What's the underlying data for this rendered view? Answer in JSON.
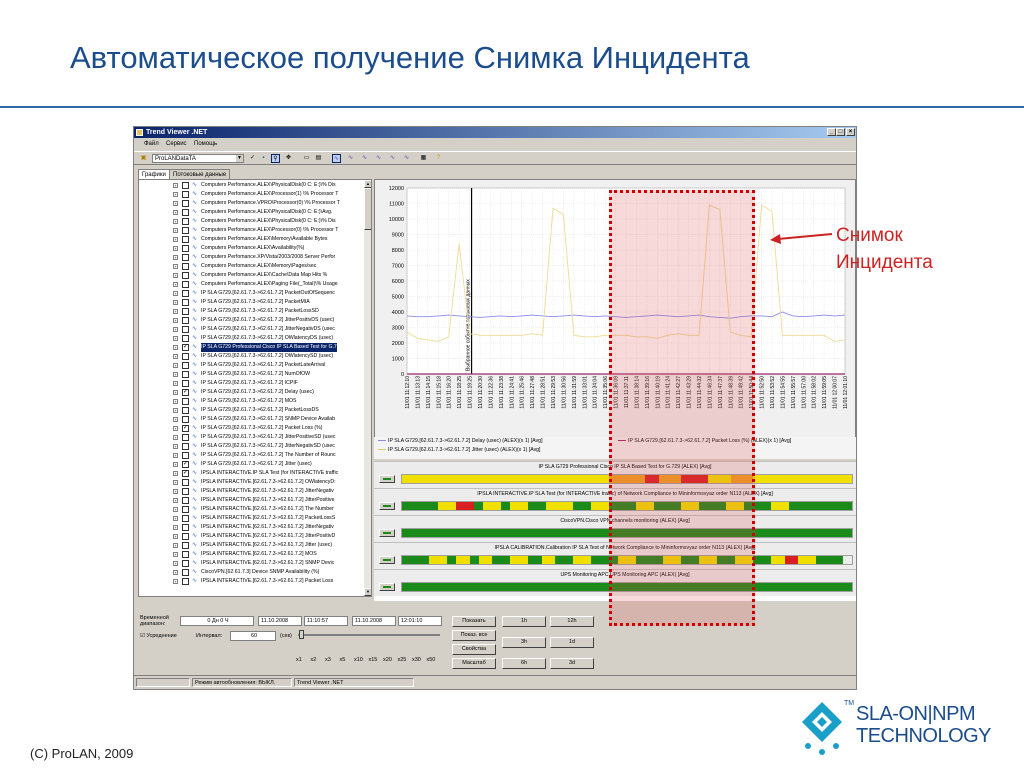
{
  "slide": {
    "title": "Автоматическое получение Снимка Инцидента",
    "footer": "(C) ProLAN, 2009",
    "callout_line1": "Снимок",
    "callout_line2": "Инцидента",
    "logo_line1": "SLA-ON|NPM",
    "logo_line2": "TECHNOLOGY",
    "logo_tm": "TM"
  },
  "colors": {
    "title": "#1b4d8c",
    "callout": "#cc2222",
    "highlight_border": "#cc0000",
    "status_green": "#1a8a1a",
    "status_yellow": "#f0e000",
    "status_red": "#d82020"
  },
  "window": {
    "title": "Trend Viewer .NET",
    "menu": [
      "Файл",
      "Сервис",
      "Помощь"
    ],
    "toolbar": {
      "source_combo": "ProLANDataTA"
    },
    "tabs": [
      "Графики",
      "Потоковые данные"
    ],
    "tree_items": [
      {
        "label": "Computers Perfomance.ALEX\\PhysicalDisk(0 C: E:)\\% Dis",
        "checked": false,
        "selected": false
      },
      {
        "label": "Computers Perfomance.ALEX\\Processor(1) \\% Processor T",
        "checked": false,
        "selected": false
      },
      {
        "label": "Computers Perfomance.VPRO\\Processor(0) \\% Processor T",
        "checked": false,
        "selected": false
      },
      {
        "label": "Computers Perfomance.ALEX\\PhysicalDisk(0 C: E:)\\Avg.",
        "checked": false,
        "selected": false
      },
      {
        "label": "Computers Perfomance.ALEX\\PhysicalDisk(0 C: E:)\\% Dis",
        "checked": false,
        "selected": false
      },
      {
        "label": "Computers Perfomance.ALEX\\Processor(0) \\% Processor T",
        "checked": false,
        "selected": false
      },
      {
        "label": "Computers Perfomance.ALEX\\Memory\\Available Bytes",
        "checked": false,
        "selected": false
      },
      {
        "label": "Computers Perfomance.ALEX\\Availability(%)",
        "checked": false,
        "selected": false
      },
      {
        "label": "Computers Perfomance.XP/Vista/2003/2008 Server Perfor",
        "checked": false,
        "selected": false
      },
      {
        "label": "Computers Perfomance.ALEX\\Memory\\Pages/sec",
        "checked": false,
        "selected": false
      },
      {
        "label": "Computers Perfomance.ALEX\\Cache\\Data Map Hits %",
        "checked": false,
        "selected": false
      },
      {
        "label": "Computers Perfomance.ALEX\\Paging File(_Total)\\% Usage",
        "checked": false,
        "selected": false
      },
      {
        "label": "IP SLA G729.[62.61.7.3->62.61.7.2]  PacketOutOfSequenc",
        "checked": false,
        "selected": false
      },
      {
        "label": "IP SLA G729.[62.61.7.3->62.61.7.2]  PacketMIA",
        "checked": false,
        "selected": false
      },
      {
        "label": "IP SLA G729.[62.61.7.3->62.61.7.2]  PacketLossSD",
        "checked": false,
        "selected": false
      },
      {
        "label": "IP SLA G729.[62.61.7.3->62.61.7.2]  JitterPositivDS (usec)",
        "checked": false,
        "selected": false
      },
      {
        "label": "IP SLA G729.[62.61.7.3->62.61.7.2]  JitterNegativDS (usec",
        "checked": false,
        "selected": false
      },
      {
        "label": "IP SLA G729.[62.61.7.3->62.61.7.2]  OWlatencyDS (usec)",
        "checked": false,
        "selected": false
      },
      {
        "label": "IP SLA G729 Professional Cisco IP SLA Based Test for G.7",
        "checked": true,
        "selected": true
      },
      {
        "label": "IP SLA G729.[62.61.7.3->62.61.7.2]  OWlatencySD (usec)",
        "checked": false,
        "selected": false
      },
      {
        "label": "IP SLA G729.[62.61.7.3->62.61.7.2]  PacketLateArrival",
        "checked": false,
        "selected": false
      },
      {
        "label": "IP SLA G729.[62.61.7.3->62.61.7.2]  NumOfOW",
        "checked": false,
        "selected": false
      },
      {
        "label": "IP SLA G729.[62.61.7.3->62.61.7.2]  ICPIF",
        "checked": false,
        "selected": false
      },
      {
        "label": "IP SLA G729.[62.61.7.3->62.61.7.2]  Delay (usec)",
        "checked": true,
        "selected": false
      },
      {
        "label": "IP SLA G729.[62.61.7.3->62.61.7.2]  MOS",
        "checked": false,
        "selected": false
      },
      {
        "label": "IP SLA G729.[62.61.7.3->62.61.7.2]  PacketLossDS",
        "checked": false,
        "selected": false
      },
      {
        "label": "IP SLA G729.[62.61.7.3->62.61.7.2]  SNMP Device Availab",
        "checked": false,
        "selected": false
      },
      {
        "label": "IP SLA G729.[62.61.7.3->62.61.7.2]  Packet Loss (%)",
        "checked": true,
        "selected": false
      },
      {
        "label": "IP SLA G729.[62.61.7.3->62.61.7.2]  JitterPositiveSD (usec",
        "checked": false,
        "selected": false
      },
      {
        "label": "IP SLA G729.[62.61.7.3->62.61.7.2]  JitterNegativSD (usec",
        "checked": false,
        "selected": false
      },
      {
        "label": "IP SLA G729.[62.61.7.3->62.61.7.2]  The Number of Rounc",
        "checked": false,
        "selected": false
      },
      {
        "label": "IP SLA G729.[62.61.7.3->62.61.7.2]  Jitter (usec)",
        "checked": true,
        "selected": false
      },
      {
        "label": "IPSLA INTERACTIVE.IP SLA Test (for INTERACTIVE traffic",
        "checked": true,
        "selected": false
      },
      {
        "label": "IPSLA INTERACTIVE.[62.61.7.3->62.61.7.2]  OWlatencyD:",
        "checked": false,
        "selected": false
      },
      {
        "label": "IPSLA INTERACTIVE.[62.61.7.3->62.61.7.2]  JitterNegativ",
        "checked": false,
        "selected": false
      },
      {
        "label": "IPSLA INTERACTIVE.[62.61.7.3->62.61.7.2]  JitterPositive",
        "checked": false,
        "selected": false
      },
      {
        "label": "IPSLA INTERACTIVE.[62.61.7.3->62.61.7.2]  The Number",
        "checked": false,
        "selected": false
      },
      {
        "label": "IPSLA INTERACTIVE.[62.61.7.3->62.61.7.2]  PacketLossS",
        "checked": false,
        "selected": false
      },
      {
        "label": "IPSLA INTERACTIVE.[62.61.7.3->62.61.7.2]  JitterNegativ",
        "checked": false,
        "selected": false
      },
      {
        "label": "IPSLA INTERACTIVE.[62.61.7.3->62.61.7.2]  JitterPositivD",
        "checked": false,
        "selected": false
      },
      {
        "label": "IPSLA INTERACTIVE.[62.61.7.3->62.61.7.2]  Jitter (usec)",
        "checked": false,
        "selected": false
      },
      {
        "label": "IPSLA INTERACTIVE.[62.61.7.3->62.61.7.2]  MOS",
        "checked": false,
        "selected": false
      },
      {
        "label": "IPSLA INTERACTIVE.[62.61.7.3->62.61.7.2]  SNMP Devic",
        "checked": false,
        "selected": false
      },
      {
        "label": "CiscoVPN.[62.61.7.3] Device SNMP Availability (%)",
        "checked": false,
        "selected": false
      },
      {
        "label": "IPSLA INTERACTIVE.[62.61.7.3->62.61.7.2]  Packet Loss",
        "checked": false,
        "selected": false
      }
    ],
    "chart_data": {
      "type": "line",
      "ylim": [
        0,
        12000
      ],
      "yticks": [
        0,
        1000,
        2000,
        3000,
        4000,
        5000,
        6000,
        7000,
        8000,
        9000,
        10000,
        11000,
        12000
      ],
      "x_labels": [
        "11/01 11:12:10",
        "11/01 11:13:13",
        "11/01 11:14:15",
        "11/01 11:15:18",
        "11/01 11:16:20",
        "11/01 11:18:25",
        "11/01 11:19:25",
        "11/01 11:20:30",
        "11/01 11:22:36",
        "11/01 11:23:38",
        "11/01 11:24:41",
        "11/01 11:25:46",
        "11/01 11:27:48",
        "11/01 11:28:51",
        "11/01 11:29:53",
        "11/01 11:30:56",
        "11/01 11:31:59",
        "11/01 11:33:01",
        "11/01 11:34:04",
        "11/01 11:35:06",
        "11/01 11:36:09",
        "11/01 11:37:11",
        "11/01 11:38:14",
        "11/01 11:39:16",
        "11/01 11:40:19",
        "11/01 11:41:24",
        "11/01 11:42:27",
        "11/01 11:43:29",
        "11/01 11:44:32",
        "11/01 11:46:34",
        "11/01 11:47:37",
        "11/01 11:48:39",
        "11/01 11:49:42",
        "11/01 11:50:44",
        "11/01 11:52:50",
        "11/01 11:53:52",
        "11/01 11:54:55",
        "11/01 11:55:57",
        "11/01 11:57:00",
        "11/01 11:58:02",
        "11/01 11:59:05",
        "11/01 12:00:07",
        "11/01 12:01:10"
      ],
      "marker_label": "Выбранное событие потоковых данных",
      "marker_index": 6,
      "series": [
        {
          "name": "IP SLA G729.[62.61.7.3->62.61.7.2]  Delay (usec) (ALEX)(x 1) [Avg]",
          "color": "#8a8aee",
          "values": [
            3750,
            3700,
            3700,
            3750,
            3800,
            3750,
            3700,
            3650,
            3700,
            3750,
            3700,
            3750,
            3800,
            3750,
            3700,
            3750,
            3800,
            3750,
            3700,
            3750,
            3700,
            3650,
            3700,
            3750,
            3800,
            3750,
            3700,
            3750,
            3800,
            3700,
            3650,
            3600,
            3700,
            3750,
            3750,
            3700,
            4000,
            3750,
            3700,
            3750,
            3800,
            3750,
            3800
          ]
        },
        {
          "name": "IP SLA G729.[62.61.7.3->62.61.7.2]  Packet Loss (%) (ALEX)(x 1) [Avg]",
          "color": "#9a2a6a",
          "values": [
            0,
            0,
            0,
            0,
            0,
            0,
            0,
            0,
            0,
            0,
            0,
            0,
            0,
            0,
            0,
            0,
            0,
            0,
            0,
            0,
            0,
            0,
            0,
            0,
            0,
            0,
            0,
            0,
            0,
            0,
            0,
            0,
            0,
            0,
            0,
            0,
            0,
            0,
            0,
            0,
            0,
            0,
            0
          ]
        },
        {
          "name": "IP SLA G729.[62.61.7.3->62.61.7.2]  Jitter (usec) (ALEX)(x 1) [Avg]",
          "color": "#f0e0a0",
          "values": [
            2700,
            2300,
            2200,
            2100,
            2400,
            8400,
            2600,
            2500,
            2500,
            2500,
            2500,
            2500,
            2600,
            2500,
            10700,
            10300,
            2500,
            2400,
            2400,
            2500,
            2500,
            2500,
            2400,
            2400,
            2300,
            2500,
            2600,
            2500,
            2500,
            10900,
            10600,
            2700,
            2500,
            2400,
            10900,
            10500,
            2500,
            2500,
            2500,
            2500,
            2500,
            2100,
            2200
          ]
        }
      ]
    },
    "status_rows": [
      {
        "title": "IP SLA G729 Professional Cisco IP SLA Based Test for G.729 (ALEX) [Avg]",
        "segments": [
          [
            "y",
            0.46
          ],
          [
            "o",
            0.08
          ],
          [
            "r",
            0.03
          ],
          [
            "o",
            0.05
          ],
          [
            "r",
            0.06
          ],
          [
            "y",
            0.05
          ],
          [
            "o",
            0.05
          ],
          [
            "y",
            0.22
          ]
        ]
      },
      {
        "title": "IPSLA INTERACTIVE.IP SLA Test (for INTERACTIVE traffic) of Network Compliance to Mininformsvyaz order N113 (ALEX) [Avg]",
        "segments": [
          [
            "g",
            0.08
          ],
          [
            "y",
            0.04
          ],
          [
            "r",
            0.04
          ],
          [
            "g",
            0.02
          ],
          [
            "y",
            0.04
          ],
          [
            "g",
            0.02
          ],
          [
            "y",
            0.04
          ],
          [
            "g",
            0.04
          ],
          [
            "y",
            0.06
          ],
          [
            "g",
            0.04
          ],
          [
            "y",
            0.04
          ],
          [
            "g",
            0.06
          ],
          [
            "y",
            0.04
          ],
          [
            "g",
            0.06
          ],
          [
            "y",
            0.04
          ],
          [
            "g",
            0.06
          ],
          [
            "y",
            0.04
          ],
          [
            "g",
            0.06
          ],
          [
            "y",
            0.04
          ],
          [
            "g",
            0.14
          ]
        ]
      },
      {
        "title": "CiscoVPN.Cisco VPN channels monitoring (ALEX) [Avg]",
        "segments": [
          [
            "g",
            1.0
          ]
        ]
      },
      {
        "title": "IPSLA CALIBRATION.Calibration IP SLA Test of Network Compliance to Mininformsvyaz order N113 (ALEX) [Avg]",
        "segments": [
          [
            "g",
            0.06
          ],
          [
            "y",
            0.04
          ],
          [
            "g",
            0.02
          ],
          [
            "y",
            0.03
          ],
          [
            "g",
            0.02
          ],
          [
            "y",
            0.03
          ],
          [
            "g",
            0.04
          ],
          [
            "y",
            0.04
          ],
          [
            "g",
            0.03
          ],
          [
            "y",
            0.03
          ],
          [
            "g",
            0.04
          ],
          [
            "y",
            0.04
          ],
          [
            "g",
            0.06
          ],
          [
            "y",
            0.04
          ],
          [
            "g",
            0.06
          ],
          [
            "y",
            0.04
          ],
          [
            "g",
            0.04
          ],
          [
            "y",
            0.04
          ],
          [
            "g",
            0.04
          ],
          [
            "y",
            0.04
          ],
          [
            "g",
            0.04
          ],
          [
            "y",
            0.03
          ],
          [
            "r",
            0.03
          ],
          [
            "y",
            0.04
          ],
          [
            "g",
            0.06
          ]
        ]
      },
      {
        "title": "UPS Monitoring APC.UPS Monitoring APC (ALEX) [Avg]",
        "segments": [
          [
            "g",
            1.0
          ]
        ]
      }
    ],
    "controls": {
      "range_label": "Временной диапазон:",
      "range_value": "0 Дн 0 Ч",
      "date_from": "11.10.2008",
      "time_from": "11:10:57",
      "date_to": "11.10.2008",
      "time_to": "12:01:10",
      "averaging_label": "Усреднение",
      "interval_label": "Интервал:",
      "interval_value": "60",
      "interval_unit": "(сек)",
      "zoom_levels": [
        "x1",
        "x2",
        "x3",
        "x5",
        "x10",
        "x15",
        "x20",
        "x25",
        "x30",
        "x50"
      ],
      "buttons": [
        "Показать",
        "Показ. все",
        "Свойства",
        "Масштаб"
      ],
      "period_buttons": [
        "1h",
        "12h",
        "3h",
        "1d",
        "6h",
        "3d"
      ]
    },
    "statusbar": {
      "autorefresh": "Режим автообновления: ВЫКЛ.",
      "app": "Trend Viewer .NET"
    }
  }
}
